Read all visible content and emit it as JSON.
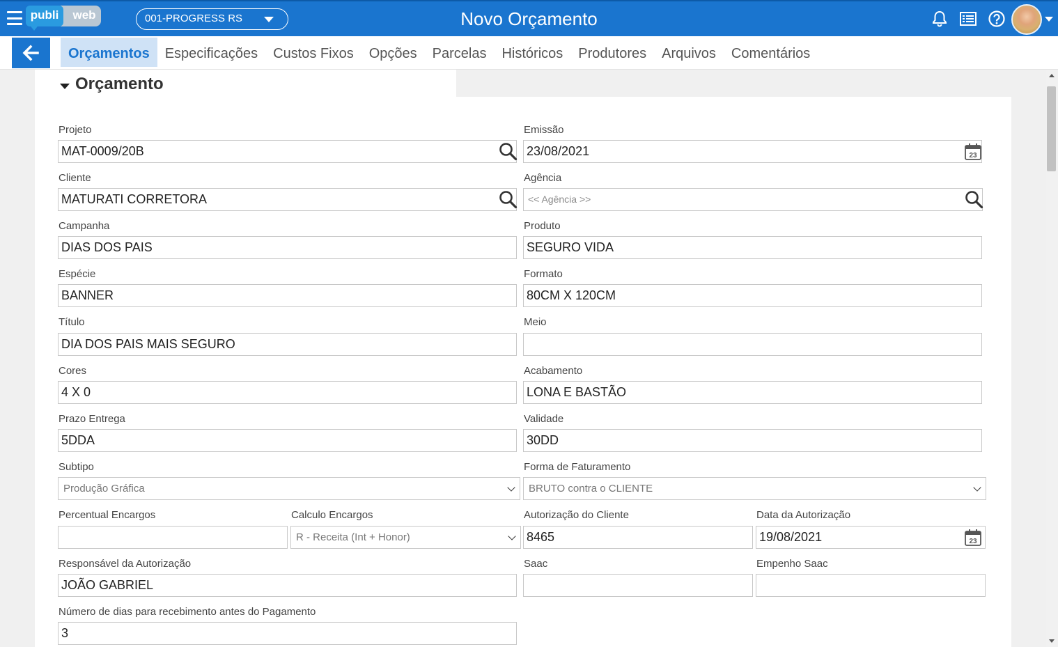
{
  "header": {
    "logo_left": "publi",
    "logo_right": "web",
    "company_select": "001-PROGRESS RS",
    "title": "Novo Orçamento",
    "icons": [
      "menu-icon",
      "bell-icon",
      "list-icon",
      "help-icon",
      "avatar",
      "chevron-down-icon"
    ]
  },
  "tabs": [
    {
      "label": "Orçamentos",
      "active": true
    },
    {
      "label": "Especificações"
    },
    {
      "label": "Custos Fixos"
    },
    {
      "label": "Opções"
    },
    {
      "label": "Parcelas"
    },
    {
      "label": "Históricos"
    },
    {
      "label": "Produtores"
    },
    {
      "label": "Arquivos"
    },
    {
      "label": "Comentários"
    }
  ],
  "section": {
    "title": "Orçamento"
  },
  "form": {
    "projeto": {
      "label": "Projeto",
      "value": "MAT-0009/20B"
    },
    "emissao": {
      "label": "Emissão",
      "value": "23/08/2021"
    },
    "cliente": {
      "label": "Cliente",
      "value": "MATURATI CORRETORA"
    },
    "agencia": {
      "label": "Agência",
      "placeholder": "<< Agência >>"
    },
    "campanha": {
      "label": "Campanha",
      "value": "DIAS DOS PAIS"
    },
    "produto": {
      "label": "Produto",
      "value": "SEGURO VIDA"
    },
    "especie": {
      "label": "Espécie",
      "value": "BANNER"
    },
    "formato": {
      "label": "Formato",
      "value": "80CM X 120CM"
    },
    "titulo": {
      "label": "Título",
      "value": "DIA DOS PAIS MAIS SEGURO"
    },
    "meio": {
      "label": "Meio",
      "value": ""
    },
    "cores": {
      "label": "Cores",
      "value": "4 X 0"
    },
    "acabamento": {
      "label": "Acabamento",
      "value": "LONA E BASTÃO"
    },
    "prazo_entrega": {
      "label": "Prazo Entrega",
      "value": "5DDA"
    },
    "validade": {
      "label": "Validade",
      "value": "30DD"
    },
    "subtipo": {
      "label": "Subtipo",
      "value": "Produção Gráfica"
    },
    "forma_faturamento": {
      "label": "Forma de Faturamento",
      "value": "BRUTO contra o CLIENTE"
    },
    "percentual_encargos": {
      "label": "Percentual Encargos",
      "value": ""
    },
    "calculo_encargos": {
      "label": "Calculo Encargos",
      "value": "R - Receita (Int + Honor)"
    },
    "autorizacao_cliente": {
      "label": "Autorização do Cliente",
      "value": "8465"
    },
    "data_autorizacao": {
      "label": "Data da Autorização",
      "value": "19/08/2021"
    },
    "responsavel_autorizacao": {
      "label": "Responsável da Autorização",
      "value": "JOÃO GABRIEL"
    },
    "saac": {
      "label": "Saac",
      "value": ""
    },
    "empenho_saac": {
      "label": "Empenho Saac",
      "value": ""
    },
    "dias_recebimento": {
      "label": "Número de dias para recebimento antes do Pagamento",
      "value": "3"
    }
  },
  "calendar_day": "23"
}
